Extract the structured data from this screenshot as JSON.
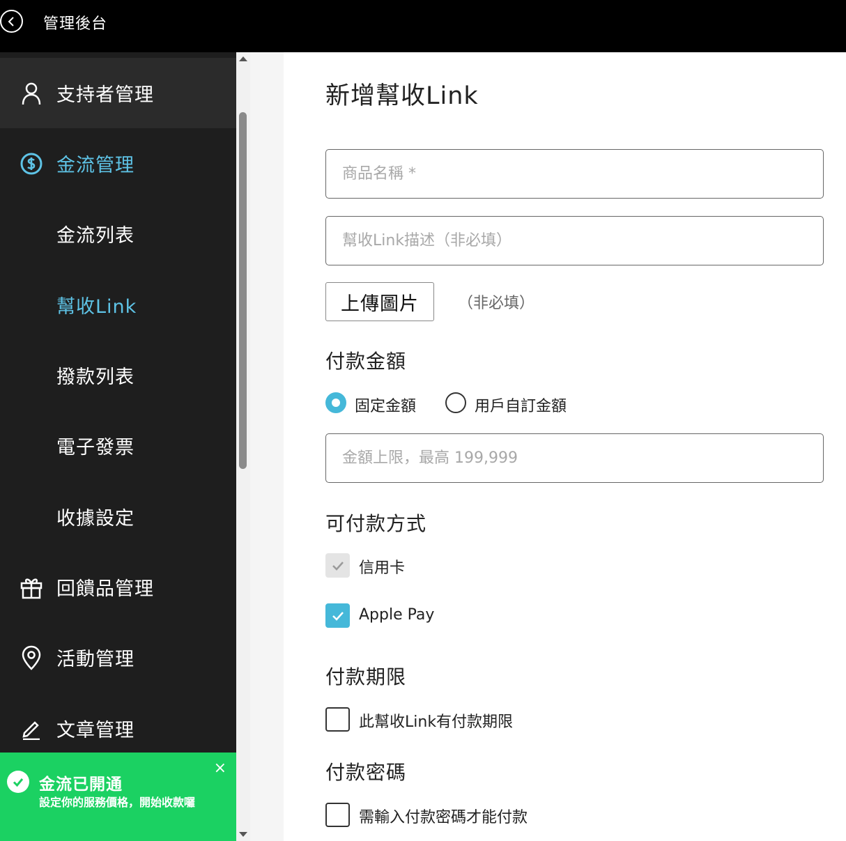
{
  "app": {
    "title": "管理後台"
  },
  "sidebar": {
    "items": [
      {
        "label": "支持者管理",
        "icon": "user-icon"
      },
      {
        "label": "金流管理",
        "icon": "dollar-circle-icon"
      },
      {
        "label": "金流列表"
      },
      {
        "label": "幫收Link"
      },
      {
        "label": "撥款列表"
      },
      {
        "label": "電子發票"
      },
      {
        "label": "收據設定"
      },
      {
        "label": "回饋品管理",
        "icon": "gift-icon"
      },
      {
        "label": "活動管理",
        "icon": "location-pin-icon"
      },
      {
        "label": "文章管理",
        "icon": "pencil-icon"
      }
    ]
  },
  "toast": {
    "title": "金流已開通",
    "body": "設定你的服務價格，開始收款囉",
    "close": "×",
    "color": "#1bd162"
  },
  "form": {
    "title": "新增幫收Link",
    "product_name_placeholder": "商品名稱 *",
    "description_placeholder": "幫收Link描述（非必填）",
    "upload_label": "上傳圖片",
    "upload_hint": "（非必填）",
    "amount": {
      "title": "付款金額",
      "options": [
        "固定金額",
        "用戶自訂金額"
      ],
      "selected": "固定金額",
      "limit_placeholder": "金額上限，最高 199,999"
    },
    "payment_methods": {
      "title": "可付款方式",
      "options": [
        {
          "label": "信用卡",
          "checked": true,
          "disabled": true
        },
        {
          "label": "Apple Pay",
          "checked": true,
          "disabled": false
        }
      ]
    },
    "deadline": {
      "title": "付款期限",
      "checkbox_label": "此幫收Link有付款期限",
      "checked": false
    },
    "password": {
      "title": "付款密碼",
      "checkbox_label": "需輸入付款密碼才能付款",
      "checked": false
    }
  },
  "colors": {
    "accent": "#45b8d9",
    "nav_accent": "#5ec3e6",
    "sidebar_bg": "#1e1e1e"
  }
}
